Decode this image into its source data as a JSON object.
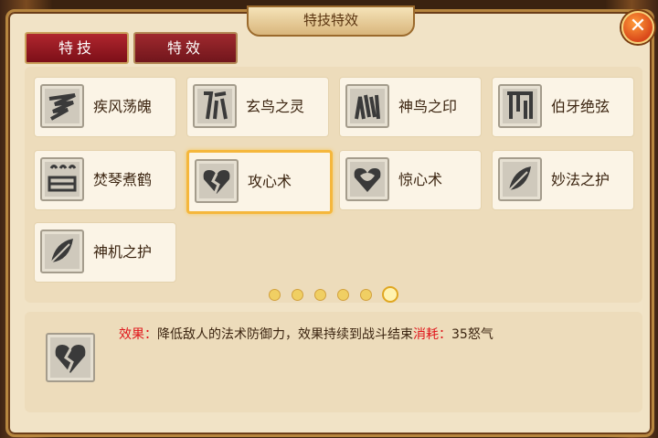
{
  "window": {
    "title": "特技特效",
    "close_label": "✕"
  },
  "tabs": [
    {
      "label": "特技",
      "active": true
    },
    {
      "label": "特效",
      "active": false
    }
  ],
  "skills": [
    {
      "name": "疾风荡魄",
      "icon": "wind-claw-icon"
    },
    {
      "name": "玄鸟之灵",
      "icon": "bird-spirit-icon"
    },
    {
      "name": "神鸟之印",
      "icon": "divine-bird-seal-icon"
    },
    {
      "name": "伯牙绝弦",
      "icon": "broken-string-icon"
    },
    {
      "name": "焚琴煮鹤",
      "icon": "burning-zither-icon"
    },
    {
      "name": "攻心术",
      "icon": "broken-heart-icon",
      "selected": true
    },
    {
      "name": "惊心术",
      "icon": "startled-heart-icon"
    },
    {
      "name": "妙法之护",
      "icon": "feather-icon"
    },
    {
      "name": "神机之护",
      "icon": "feather-icon"
    }
  ],
  "pagination": {
    "total": 6,
    "current": 6
  },
  "description": {
    "effect_label": "效果：",
    "effect_text": "降低敌人的法术防御力，效果持续到战斗结束",
    "cost_label": "消耗：",
    "cost_value": "35怒气",
    "icon": "broken-heart-icon"
  },
  "colors": {
    "accent_red": "#e0151b",
    "tab_red": "#9b1f26",
    "highlight_gold": "#f5b73c"
  }
}
